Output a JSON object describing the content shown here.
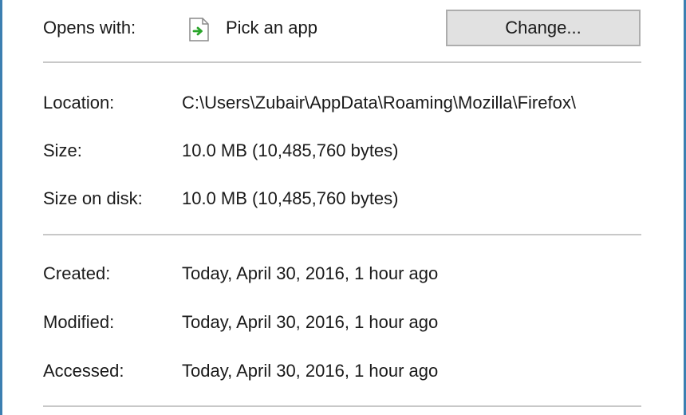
{
  "opens_with": {
    "label": "Opens with:",
    "app_name": "Pick an app",
    "app_icon": "file-with-green-arrow-icon",
    "change_button": "Change..."
  },
  "details": {
    "location_label": "Location:",
    "location_value": "C:\\Users\\Zubair\\AppData\\Roaming\\Mozilla\\Firefox\\",
    "size_label": "Size:",
    "size_value": "10.0 MB (10,485,760 bytes)",
    "size_on_disk_label": "Size on disk:",
    "size_on_disk_value": "10.0 MB (10,485,760 bytes)"
  },
  "dates": {
    "created_label": "Created:",
    "created_value": "Today, April 30, 2016, 1 hour ago",
    "modified_label": "Modified:",
    "modified_value": "Today, April 30, 2016, 1 hour ago",
    "accessed_label": "Accessed:",
    "accessed_value": "Today, April 30, 2016, 1 hour ago"
  },
  "colors": {
    "window_border": "#3c7fb1",
    "button_face": "#e1e1e1",
    "separator": "#c8c8c8",
    "arrow_green": "#2aa52a"
  }
}
